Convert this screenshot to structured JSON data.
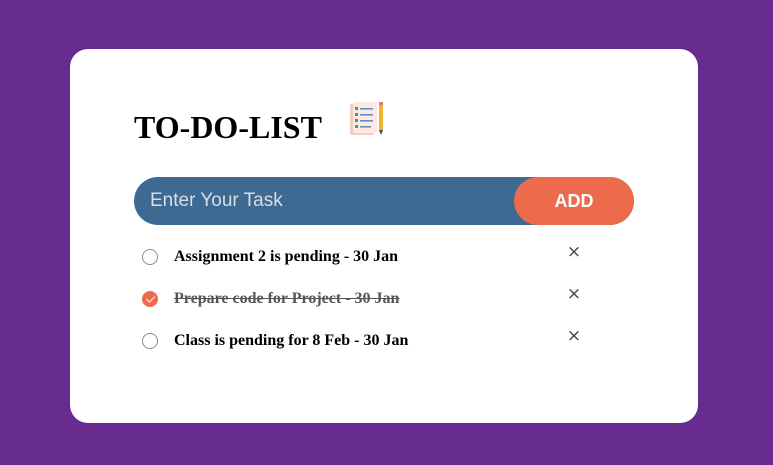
{
  "app": {
    "title": "TO-DO-LIST",
    "title_icon": "checklist-notepad-pencil-icon"
  },
  "input": {
    "placeholder": "Enter Your Task",
    "value": ""
  },
  "add_button": {
    "label": "ADD"
  },
  "tasks": [
    {
      "text": "Assignment 2 is pending - 30 Jan",
      "checked": false,
      "remove_label": "×"
    },
    {
      "text": "Prepare code for Project - 30 Jan",
      "checked": true,
      "remove_label": "×"
    },
    {
      "text": "Class is pending for 8 Feb - 30 Jan",
      "checked": false,
      "remove_label": "×"
    }
  ],
  "colors": {
    "background": "#682c91",
    "card": "#ffffff",
    "input_bar": "#3d6993",
    "accent": "#ed6a4d"
  }
}
